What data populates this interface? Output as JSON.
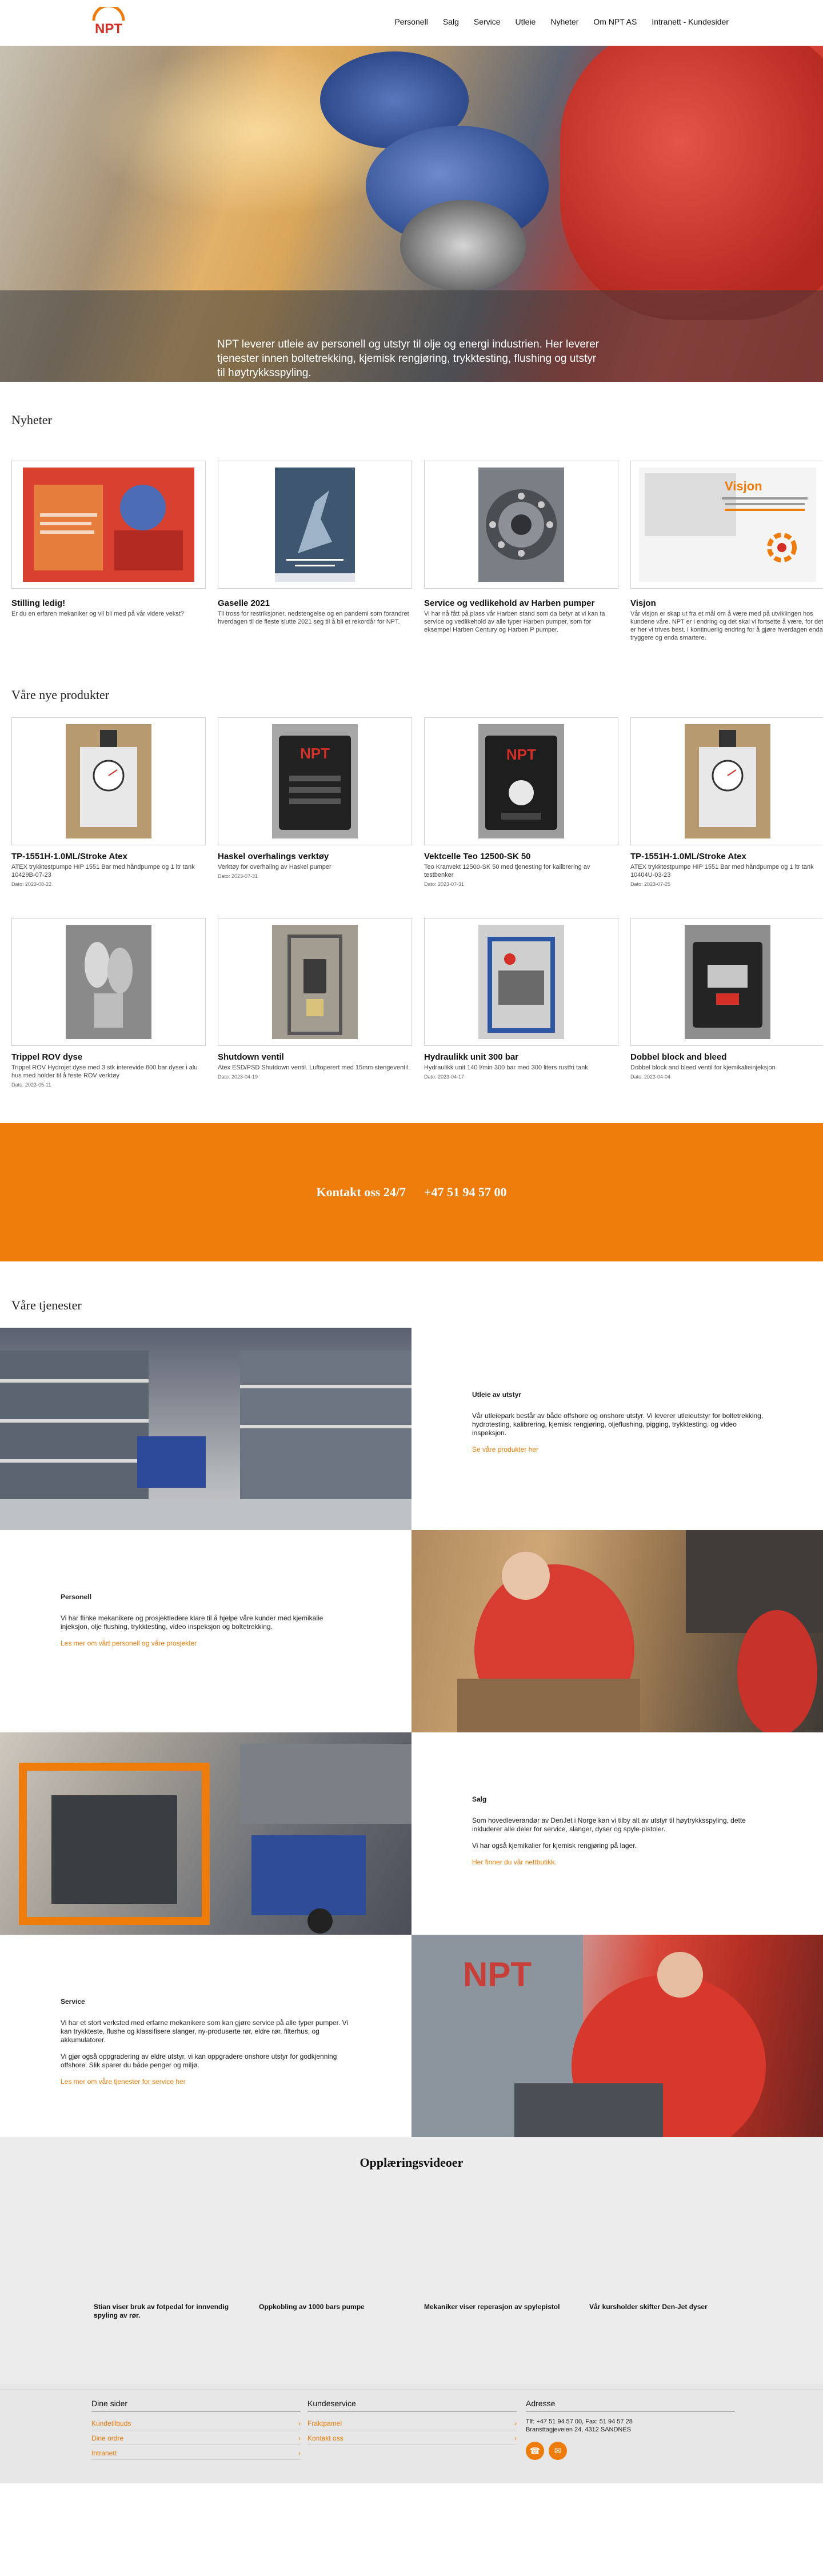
{
  "nav": [
    "Personell",
    "Salg",
    "Service",
    "Utleie",
    "Nyheter",
    "Om NPT AS",
    "Intranett - Kundesider"
  ],
  "hero": {
    "caption": "NPT leverer utleie av personell og utstyr til olje og energi industrien. Her leverer tjenester innen boltetrekking, kjemisk rengjøring, trykktesting, flushing og utstyr til høytrykksspyling."
  },
  "news": {
    "title": "Nyheter",
    "items": [
      {
        "title": "Stilling ledig!",
        "text": "Er du en erfaren mekaniker og vil bli med på vår videre vekst?"
      },
      {
        "title": "Gaselle 2021",
        "text": "Til tross for restriksjoner, nedstengelse og en pandemi som forandret hverdagen til de fleste slutte 2021 seg til å bli et rekordår for NPT."
      },
      {
        "title": "Service og vedlikehold av Harben pumper",
        "text": "Vi har nå fått på plass vår Harben stand som da betyr at vi kan ta service og vedlikehold av alle typer Harben pumper, som for eksempel Harben Century og Harben P pumper."
      },
      {
        "title": "Visjon",
        "text": "Vår visjon er skap ut fra et mål om å være med på utviklingen hos kundene våre. NPT er i endring og det skal vi fortsette å være, for det er her vi trives best. I kontinuerlig endring for å gjøre hverdagen enda tryggere og enda smartere."
      }
    ]
  },
  "products": {
    "title": "Våre nye produkter",
    "items": [
      {
        "title": "TP-1551H-1.0ML/Stroke Atex",
        "text": "ATEX trykktestpumpe HIP 1551 Bar med håndpumpe og 1 ltr tank 10429B-07-23",
        "date": "Dato: 2023-08-22"
      },
      {
        "title": "Haskel overhalings verktøy",
        "text": "Verktøy for overhaling av Haskel pumper",
        "date": "Dato: 2023-07-31"
      },
      {
        "title": "Vektcelle Teo 12500-SK 50",
        "text": "Teo Kranvekt 12500-SK 50 med tjenesting for kalibrering av testbenker",
        "date": "Dato: 2023-07-31"
      },
      {
        "title": "TP-1551H-1.0ML/Stroke Atex",
        "text": "ATEX trykktestpumpe HIP 1551 Bar med håndpumpe og 1 ltr tank 10404U-03-23",
        "date": "Dato: 2023-07-25"
      },
      {
        "title": "Trippel ROV dyse",
        "text": "Trippel ROV Hydrojet dyse med 3 stk interevide 800 bar dyser i alu hus med holder til å feste ROV verktøy",
        "date": "Dato: 2023-05-11"
      },
      {
        "title": "Shutdown ventil",
        "text": "Atex ESD/PSD Shutdown ventil. Luftoperert med 15mm stengeventil.",
        "date": "Dato: 2023-04-19"
      },
      {
        "title": "Hydraulikk unit 300 bar",
        "text": "Hydraulikk unit 140 l/min 300 bar med 300 liters rustfri tank",
        "date": "Dato: 2023-04-17"
      },
      {
        "title": "Dobbel block and bleed",
        "text": "Dobbel block and bleed ventil for kjemikalieinjeksjon",
        "date": "Dato: 2023-04-04"
      }
    ]
  },
  "contact": {
    "label": "Kontakt oss 24/7",
    "phone": "+47 51 94 57 00"
  },
  "services": {
    "title": "Våre tjenester",
    "items": [
      {
        "heading": "Utleie av utstyr",
        "paras": [
          "Vår utleiepark består av både offshore og onshore utstyr. Vi leverer utleieutstyr for boltetrekking, hydrotesting, kalibrering, kjemisk rengjøring, oljeflushing, pigging, trykktesting, og video inspeksjon."
        ],
        "link": "Se våre produkter her"
      },
      {
        "heading": "Personell",
        "paras": [
          "Vi har flinke mekanikere og prosjektledere klare til å hjelpe våre kunder med kjemikalie injeksjon, olje flushing, trykktesting, video inspeksjon og boltetrekking."
        ],
        "link": "Les mer om vårt personell og våre prosjekter"
      },
      {
        "heading": "Salg",
        "paras": [
          "Som hovedleverandør av DenJet i Norge kan vi tilby alt av utstyr til høytrykksspyling, dette inkluderer alle deler for service, slanger, dyser og spyle-pistoler.",
          "Vi har også kjemikalier for kjemisk rengjøring på lager."
        ],
        "link": "Her finner du vår nettbutikk."
      },
      {
        "heading": "Service",
        "paras": [
          "Vi har et stort verksted med erfarne mekanikere som kan gjøre service på alle typer pumper. Vi kan trykkteste, flushe og klassifisere slanger, ny-produserte rør, eldre rør, filterhus, og akkumulatorer.",
          "Vi gjør også oppgradering av eldre utstyr, vi kan oppgradere onshore utstyr for godkjenning offshore. Slik sparer du både penger og miljø."
        ],
        "link": "Les mer om våre tjenester for service her"
      }
    ]
  },
  "videos": {
    "title": "Opplæringsvideoer",
    "items": [
      "Stian viser bruk av fotpedal for innvendig spyling av rør.",
      "Oppkobling av 1000 bars pumpe",
      "Mekaniker viser reperasjon av spylepistol",
      "Vår kursholder skifter Den-Jet dyser"
    ]
  },
  "footer": {
    "col1": {
      "title": "Dine sider",
      "links": [
        "Kundetilbuds",
        "Dine ordre",
        "Intranett"
      ]
    },
    "col2": {
      "title": "Kundeservice",
      "links": [
        "Fraktpamel",
        "Kontakt oss"
      ]
    },
    "col3": {
      "title": "Adresse",
      "line1": "Tlf: +47 51 94 57 00, Fax: 51 94 57 28",
      "line2": "Bransttagjeveien 24, 4312 SANDNES"
    }
  },
  "colors": {
    "accent": "#ee7c0b",
    "brand_red": "#d32f27"
  }
}
